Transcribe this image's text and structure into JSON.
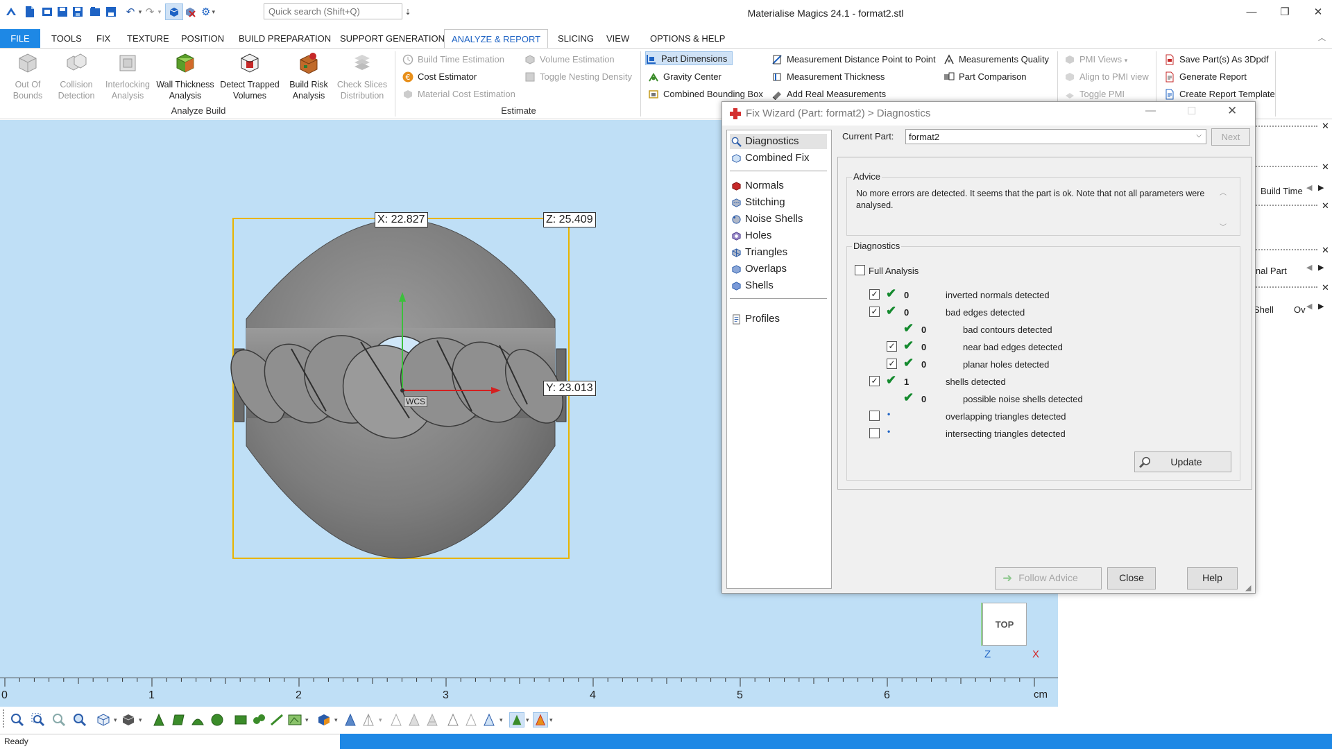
{
  "app": {
    "title": "Materialise Magics 24.1 - format2.stl"
  },
  "search": {
    "placeholder": "Quick search (Shift+Q)"
  },
  "tabs": [
    {
      "label": "FILE"
    },
    {
      "label": "TOOLS"
    },
    {
      "label": "FIX"
    },
    {
      "label": "TEXTURE"
    },
    {
      "label": "POSITION"
    },
    {
      "label": "BUILD PREPARATION"
    },
    {
      "label": "SUPPORT GENERATION"
    },
    {
      "label": "ANALYZE & REPORT"
    },
    {
      "label": "SLICING"
    },
    {
      "label": "VIEW"
    },
    {
      "label": "OPTIONS & HELP"
    }
  ],
  "ribbon": {
    "analyze_build": {
      "group_label": "Analyze Build",
      "items": [
        {
          "label": "Out Of\nBounds",
          "disabled": true
        },
        {
          "label": "Collision\nDetection",
          "disabled": true
        },
        {
          "label": "Interlocking\nAnalysis",
          "disabled": true
        },
        {
          "label": "Wall Thickness\nAnalysis",
          "disabled": false
        },
        {
          "label": "Detect Trapped\nVolumes",
          "disabled": false
        },
        {
          "label": "Build Risk\nAnalysis",
          "disabled": false
        },
        {
          "label": "Check Slices\nDistribution",
          "disabled": true
        }
      ]
    },
    "estimate": {
      "group_label": "Estimate",
      "items": [
        {
          "label": "Build Time Estimation",
          "disabled": true
        },
        {
          "label": "Cost Estimator",
          "disabled": false
        },
        {
          "label": "Material Cost Estimation",
          "disabled": true
        },
        {
          "label": "Volume Estimation",
          "disabled": true
        },
        {
          "label": "Toggle Nesting Density",
          "disabled": true
        }
      ]
    },
    "measure": {
      "items": [
        {
          "label": "Part Dimensions",
          "selected": true
        },
        {
          "label": "Gravity Center"
        },
        {
          "label": "Combined Bounding Box"
        },
        {
          "label": "Measurement Distance Point to Point"
        },
        {
          "label": "Measurement Thickness"
        },
        {
          "label": "Add Real Measurements"
        },
        {
          "label": "Measurements Quality"
        },
        {
          "label": "Part Comparison"
        }
      ]
    },
    "pmi": {
      "items": [
        {
          "label": "PMI Views"
        },
        {
          "label": "Align to PMI view"
        },
        {
          "label": "Toggle PMI"
        }
      ]
    },
    "report": {
      "items": [
        {
          "label": "Save Part(s) As 3Dpdf"
        },
        {
          "label": "Generate Report"
        },
        {
          "label": "Create Report Template"
        }
      ]
    }
  },
  "viewport": {
    "dim_x": "X: 22.827",
    "dim_z": "Z: 25.409",
    "dim_y": "Y: 23.013",
    "wcs": "WCS",
    "view_cube": "TOP",
    "axis_z": "Z",
    "axis_x": "X",
    "ruler": {
      "labels": [
        "0",
        "1",
        "2",
        "3",
        "4",
        "5",
        "6"
      ],
      "unit": "cm"
    }
  },
  "right_panel": {
    "build_time": "Build Time",
    "final_part": "inal Part",
    "shell": "Shell",
    "ov": "Ov"
  },
  "dialog": {
    "title": "Fix Wizard (Part: format2) > Diagnostics",
    "nav": [
      {
        "label": "Diagnostics",
        "selected": true
      },
      {
        "label": "Combined Fix"
      },
      {
        "label": "Normals"
      },
      {
        "label": "Stitching"
      },
      {
        "label": "Noise Shells"
      },
      {
        "label": "Holes"
      },
      {
        "label": "Triangles"
      },
      {
        "label": "Overlaps"
      },
      {
        "label": "Shells"
      },
      {
        "label": "Profiles"
      }
    ],
    "current_part_label": "Current Part:",
    "current_part_value": "format2",
    "next_label": "Next",
    "advice_title": "Advice",
    "advice_text": "No more errors are detected. It seems that the part is ok. Note that not all parameters were analysed.",
    "diagnostics_title": "Diagnostics",
    "full_analysis_label": "Full Analysis",
    "full_analysis_checked": false,
    "rows": [
      {
        "checked": true,
        "status": "ok",
        "count": "0",
        "label": "inverted normals detected",
        "indent": 0
      },
      {
        "checked": true,
        "status": "ok",
        "count": "0",
        "label": "bad edges detected",
        "indent": 0
      },
      {
        "checked": null,
        "status": "ok",
        "count": "0",
        "label": "bad contours detected",
        "indent": 1
      },
      {
        "checked": true,
        "status": "ok",
        "count": "0",
        "label": "near bad edges detected",
        "indent": 1
      },
      {
        "checked": true,
        "status": "ok",
        "count": "0",
        "label": "planar holes detected",
        "indent": 1
      },
      {
        "checked": true,
        "status": "ok",
        "count": "1",
        "label": "shells detected",
        "indent": 0
      },
      {
        "checked": null,
        "status": "ok",
        "count": "0",
        "label": "possible noise shells detected",
        "indent": 1
      },
      {
        "checked": false,
        "status": "none",
        "count": "",
        "label": "overlapping triangles detected",
        "indent": 0
      },
      {
        "checked": false,
        "status": "none",
        "count": "",
        "label": "intersecting triangles detected",
        "indent": 0
      }
    ],
    "update_label": "Update",
    "follow_advice_label": "Follow Advice",
    "close_label": "Close",
    "help_label": "Help"
  },
  "status": {
    "text": "Ready"
  },
  "colors": {
    "accent": "#1e88e5",
    "viewport_bg": "#bfdff6",
    "ok_tick": "#148a2e",
    "bbox": "#e8b400"
  }
}
